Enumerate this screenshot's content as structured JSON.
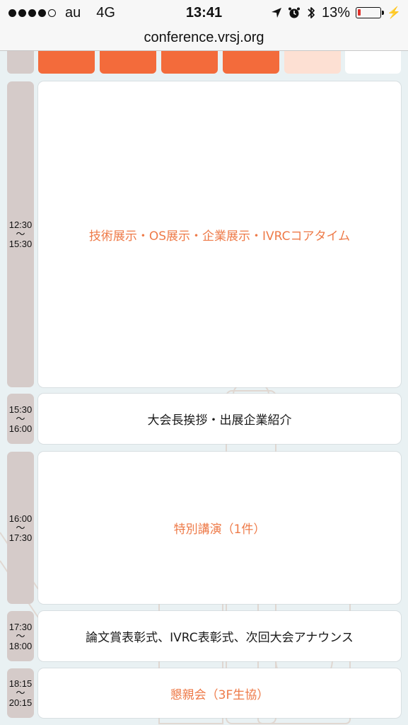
{
  "status_bar": {
    "carrier": "au",
    "network": "4G",
    "time": "13:41",
    "battery_percent": "13%",
    "battery_level": 0.13,
    "battery_color": "#e0302a",
    "signal_strength": 4,
    "icons": [
      "location-arrow-icon",
      "alarm-icon",
      "bluetooth-icon",
      "battery-icon",
      "charging-bolt-icon"
    ]
  },
  "url_bar": {
    "url": "conference.vrsj.org"
  },
  "colors": {
    "accent_orange": "#ee7a48",
    "tab_orange": "#f36b3b",
    "tab_light": "#fde0d3",
    "time_column": "#d5cbc9"
  },
  "schedule": {
    "rows": [
      {
        "time_start": "12:30",
        "time_end": "15:30",
        "title": "技術展示・OS展示・企業展示・IVRCコアタイム",
        "style": "orange"
      },
      {
        "time_start": "15:30",
        "time_end": "16:00",
        "title": "大会長挨拶・出展企業紹介",
        "style": "dark"
      },
      {
        "time_start": "16:00",
        "time_end": "17:30",
        "title": "特別講演（1件）",
        "style": "orange"
      },
      {
        "time_start": "17:30",
        "time_end": "18:00",
        "title": "論文賞表彰式、IVRC表彰式、次回大会アナウンス",
        "style": "dark"
      },
      {
        "time_start": "18:15",
        "time_end": "20:15",
        "title": "懇親会（3F生協）",
        "style": "orange"
      }
    ],
    "tilde": "〜"
  }
}
